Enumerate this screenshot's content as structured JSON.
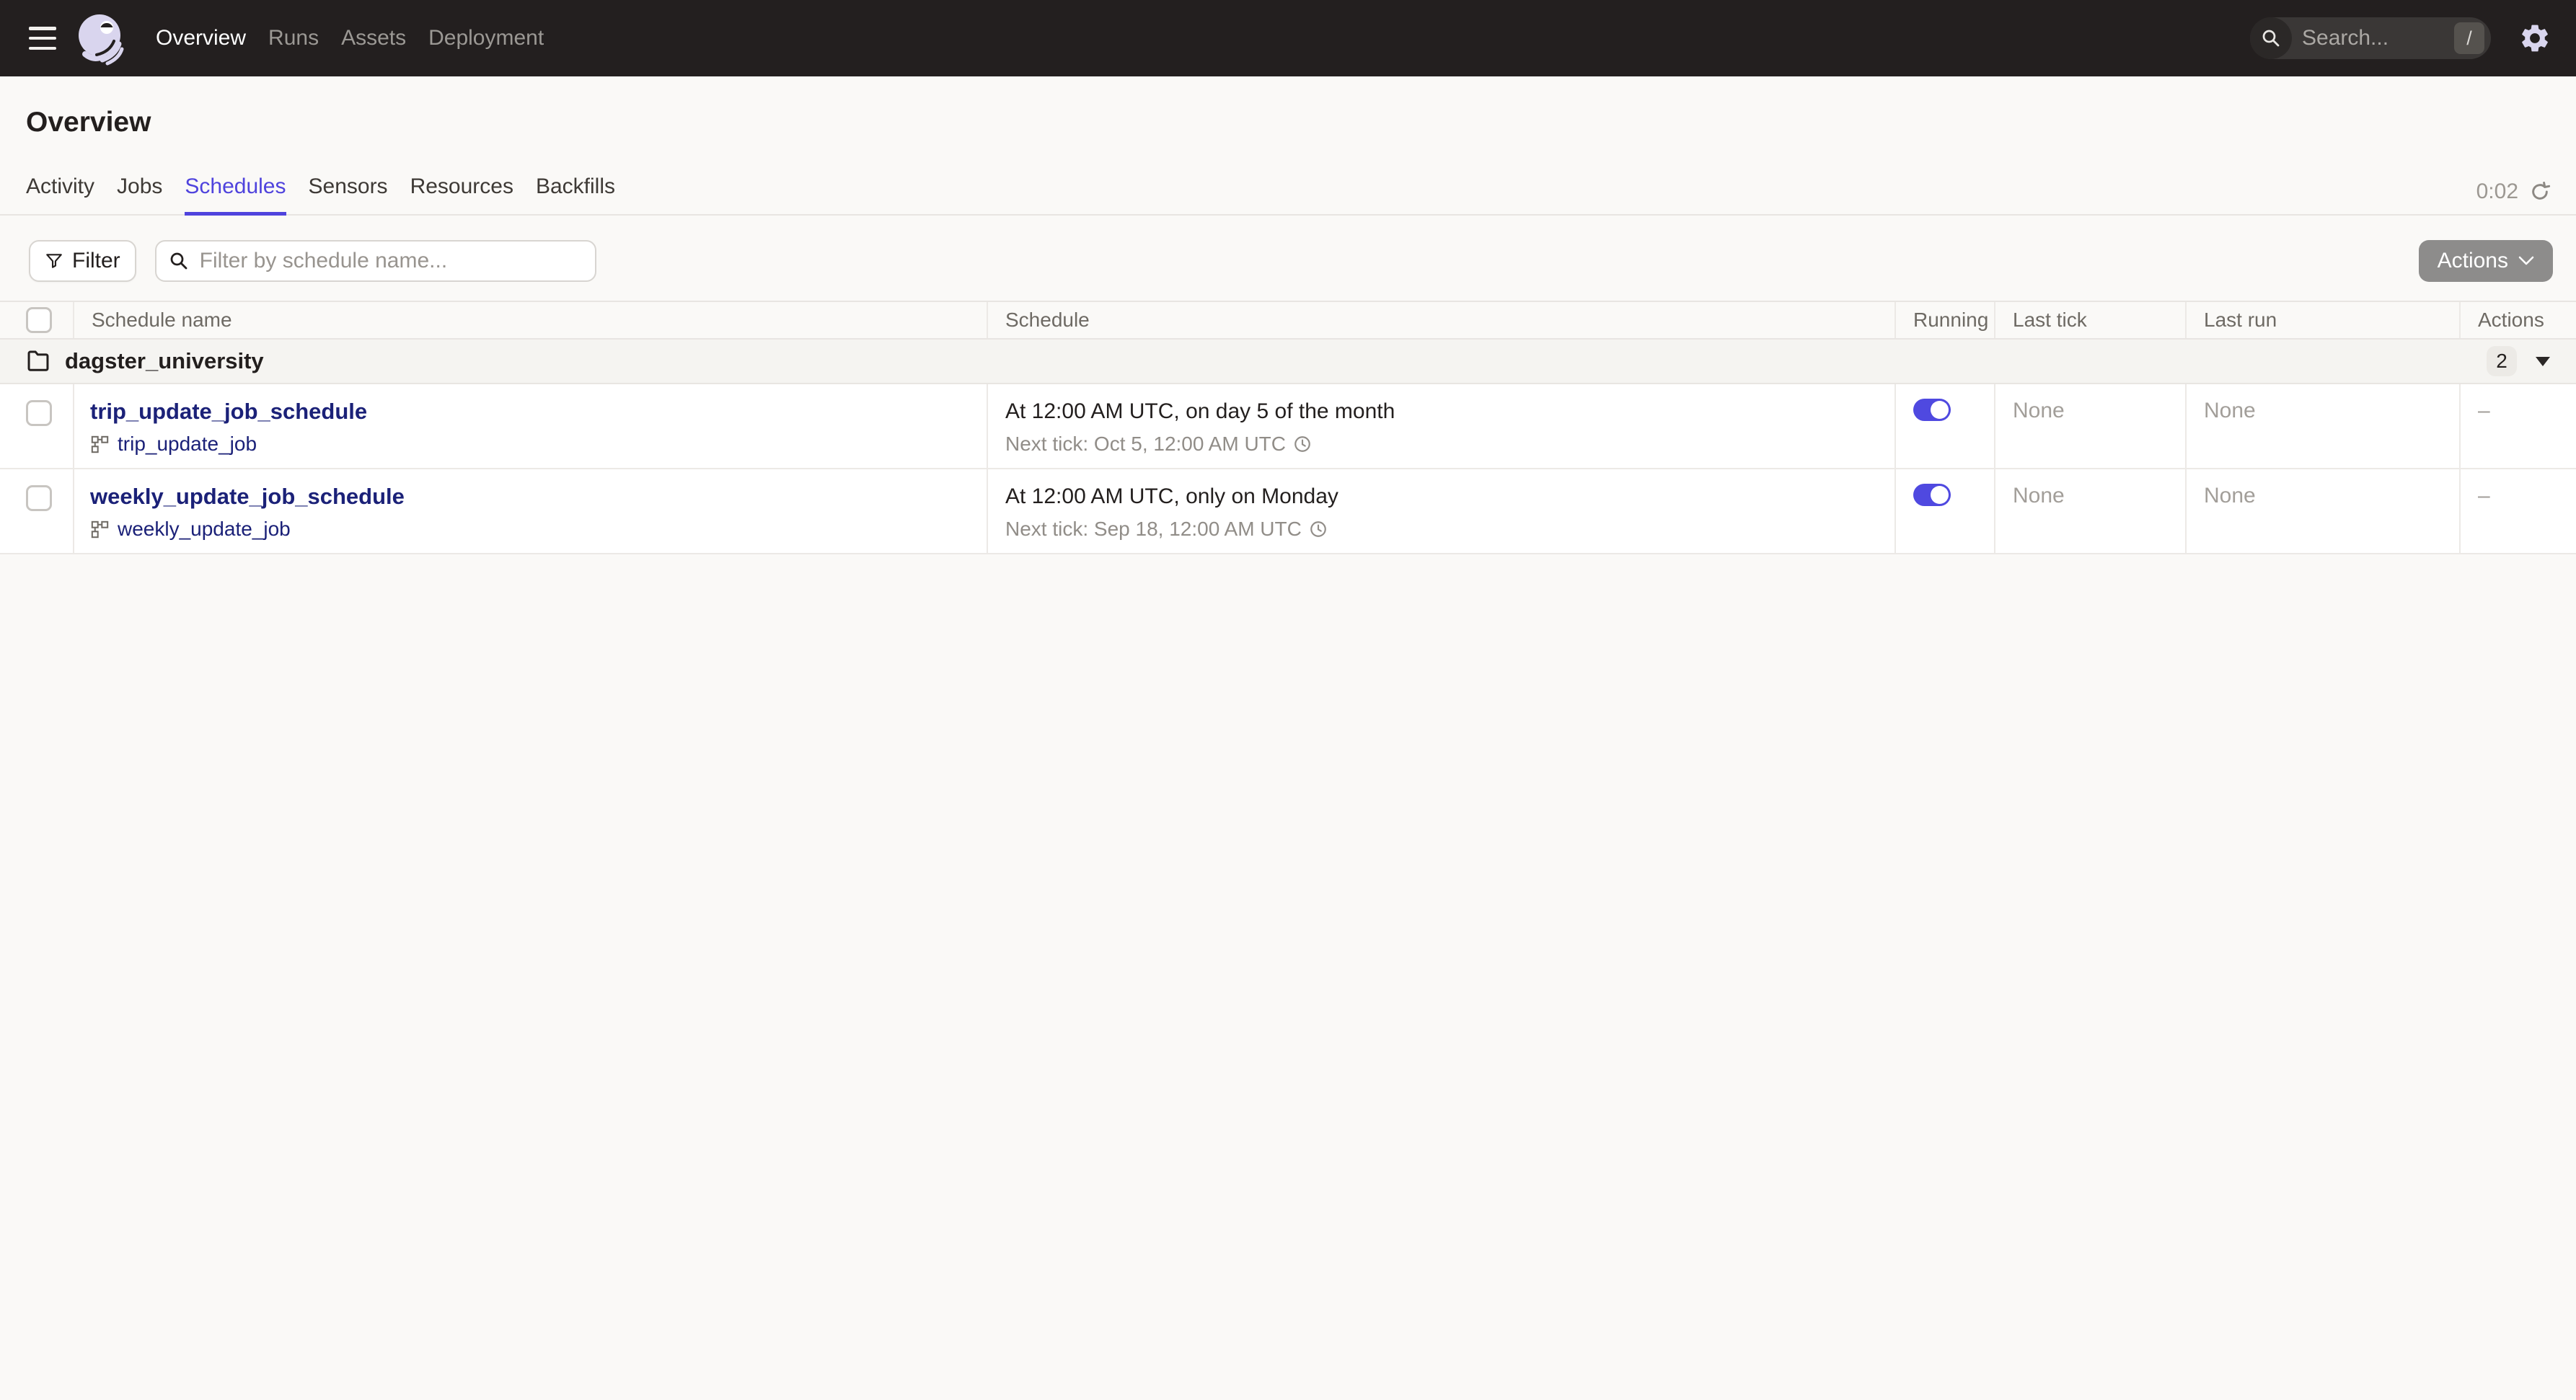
{
  "colors": {
    "accent": "#4F43DD",
    "nav_bg": "#231F1F",
    "link": "#1B2178",
    "toggle_on": "#4F49E0",
    "page_bg": "#FAF9F7"
  },
  "nav": {
    "items": [
      {
        "label": "Overview"
      },
      {
        "label": "Runs"
      },
      {
        "label": "Assets"
      },
      {
        "label": "Deployment"
      }
    ],
    "search_placeholder": "Search...",
    "search_shortcut": "/"
  },
  "page": {
    "title": "Overview",
    "refresh_timer": "0:02"
  },
  "tabs": {
    "items": [
      {
        "label": "Activity"
      },
      {
        "label": "Jobs"
      },
      {
        "label": "Schedules"
      },
      {
        "label": "Sensors"
      },
      {
        "label": "Resources"
      },
      {
        "label": "Backfills"
      }
    ]
  },
  "toolbar": {
    "filter_label": "Filter",
    "search_placeholder": "Filter by schedule name...",
    "actions_label": "Actions"
  },
  "table": {
    "headers": {
      "name": "Schedule name",
      "schedule": "Schedule",
      "running": "Running",
      "last_tick": "Last tick",
      "last_run": "Last run",
      "actions": "Actions"
    },
    "group": {
      "name": "dagster_university",
      "count": "2"
    },
    "rows": [
      {
        "name": "trip_update_job_schedule",
        "job": "trip_update_job",
        "schedule": "At 12:00 AM UTC, on day 5 of the month",
        "next_tick": "Next tick: Oct 5, 12:00 AM UTC",
        "running": "true",
        "last_tick": "None",
        "last_run": "None",
        "actions": "–"
      },
      {
        "name": "weekly_update_job_schedule",
        "job": "weekly_update_job",
        "schedule": "At 12:00 AM UTC, only on Monday",
        "next_tick": "Next tick: Sep 18, 12:00 AM UTC",
        "running": "true",
        "last_tick": "None",
        "last_run": "None",
        "actions": "–"
      }
    ]
  }
}
